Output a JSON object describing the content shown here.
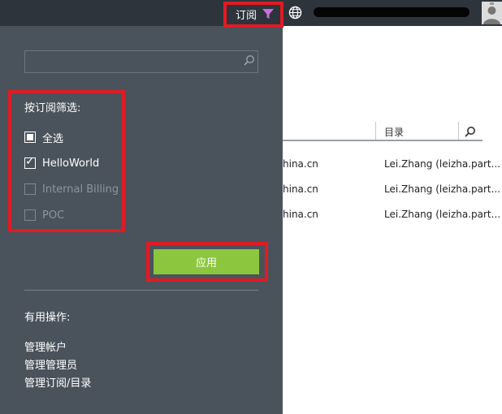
{
  "topbar": {
    "subscription_filter_label": "订阅",
    "colors": {
      "bar": "#2e343b",
      "funnel": "#c86fd8"
    },
    "icons": [
      "funnel-icon",
      "globe-icon",
      "avatar"
    ]
  },
  "panel": {
    "search": {
      "placeholder": "",
      "value": ""
    },
    "filter_title": "按订阅筛选:",
    "options": [
      {
        "label": "全选",
        "state": "indeterminate",
        "enabled": true
      },
      {
        "label": "HelloWorld",
        "state": "checked",
        "enabled": true
      },
      {
        "label": "Internal Billing",
        "state": "unchecked",
        "enabled": false
      },
      {
        "label": "POC",
        "state": "unchecked",
        "enabled": false
      }
    ],
    "apply_label": "应用",
    "actions_title": "有用操作:",
    "actions": [
      "管理帐户",
      "管理管理员",
      "管理订阅/目录"
    ],
    "colors": {
      "panel": "#4a535c",
      "apply": "#8cc63e",
      "highlight": "#e01b24"
    }
  },
  "main": {
    "column_title": "目录",
    "rows": [
      {
        "domain": "hina.cn",
        "directory": "Lei.Zhang (leizha.part..."
      },
      {
        "domain": "hina.cn",
        "directory": "Lei.Zhang (leizha.part..."
      },
      {
        "domain": "hina.cn",
        "directory": "Lei.Zhang (leizha.part..."
      }
    ]
  }
}
